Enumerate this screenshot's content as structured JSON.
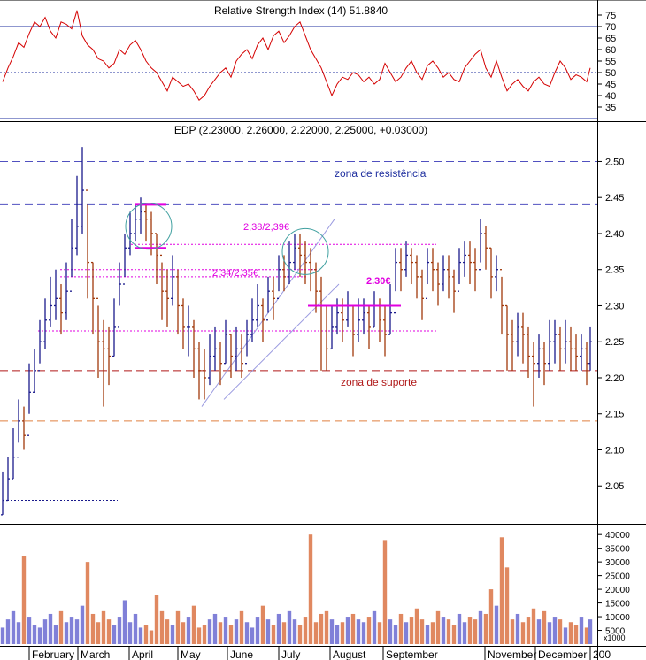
{
  "colors": {
    "up": "#1a1a8c",
    "down": "#a0380a",
    "rsi_line": "#d40000",
    "level_blue": "#1f2f9f",
    "resistance": "#5050c0",
    "support_red": "#b01818",
    "support_orange": "#e08040",
    "annotation": "#e000e0",
    "circle": "#40a0a0",
    "vol_up": "#8080d8",
    "vol_down": "#e08860",
    "channel": "#9a9ae0"
  },
  "chart_data": [
    {
      "type": "line",
      "title": "Relative Strength Index (14) 51.8840",
      "yticks": [
        35,
        40,
        45,
        50,
        55,
        60,
        65,
        70,
        75
      ],
      "ylim": [
        30,
        80
      ],
      "reference_levels": [
        30,
        50,
        70
      ],
      "x_range": [
        0,
        664
      ],
      "series": [
        {
          "x": [
            0,
            6,
            12,
            18,
            24,
            30,
            36,
            42,
            48,
            54,
            60,
            66,
            72,
            78,
            84,
            90,
            96,
            102,
            108,
            114,
            120,
            126,
            132,
            138,
            144,
            150,
            156,
            162,
            168,
            174,
            180,
            186,
            192,
            198,
            204,
            210,
            216,
            222,
            228,
            234,
            240,
            246,
            252,
            258,
            264,
            270,
            276,
            282,
            288,
            294,
            300,
            306,
            312,
            318,
            324,
            330,
            336,
            342,
            348,
            354,
            360,
            366,
            372,
            378,
            384,
            390,
            396,
            402,
            408,
            414,
            420,
            426,
            432,
            438,
            444,
            450,
            456,
            462,
            468,
            474,
            480,
            486,
            492,
            498,
            504,
            510,
            516,
            522,
            528,
            534,
            540,
            546,
            552,
            558,
            564,
            570,
            576,
            582,
            588,
            594,
            600,
            606,
            612,
            618,
            624,
            630,
            636,
            642,
            648,
            654,
            660,
            664
          ],
          "values": [
            46,
            52,
            57,
            63,
            61,
            67,
            72,
            70,
            74,
            68,
            65,
            72,
            71,
            69,
            77,
            66,
            62,
            60,
            56,
            55,
            52,
            54,
            60,
            58,
            62,
            64,
            60,
            55,
            52,
            50,
            46,
            42,
            48,
            46,
            44,
            45,
            42,
            38,
            40,
            44,
            47,
            50,
            52,
            48,
            55,
            58,
            60,
            56,
            62,
            65,
            60,
            66,
            68,
            63,
            66,
            70,
            72,
            66,
            60,
            56,
            52,
            46,
            40,
            45,
            48,
            47,
            50,
            49,
            46,
            48,
            45,
            47,
            54,
            50,
            46,
            48,
            52,
            55,
            50,
            47,
            53,
            55,
            52,
            48,
            50,
            47,
            46,
            52,
            55,
            58,
            60,
            52,
            48,
            55,
            48,
            42,
            45,
            47,
            44,
            42,
            46,
            48,
            45,
            44,
            50,
            55,
            52,
            47,
            49,
            48,
            46,
            52
          ]
        }
      ]
    },
    {
      "type": "candlestick",
      "title": "EDP (2.23000, 2.26000, 2.22000, 2.25000, +0.03000)",
      "yticks": [
        2.05,
        2.1,
        2.15,
        2.2,
        2.25,
        2.3,
        2.35,
        2.4,
        2.45,
        2.5
      ],
      "ylim": [
        2.0,
        2.53
      ],
      "x_range": [
        0,
        664
      ],
      "xticks": [
        "February",
        "March",
        "April",
        "May",
        "June",
        "July",
        "August",
        "September",
        "November",
        "December",
        "200"
      ],
      "xtick_pos": [
        30,
        85,
        143,
        198,
        254,
        312,
        370,
        430,
        545,
        602,
        664
      ],
      "annotations": {
        "resistance_label": "zona de resistência",
        "support_label": "zona de suporte",
        "label_238": "2,38/2,39€",
        "label_234": "2,34/2,35€",
        "label_230": "2.30€"
      },
      "levels": [
        {
          "y": 2.5,
          "style": "resistance"
        },
        {
          "y": 2.44,
          "style": "resistance"
        },
        {
          "y": 2.21,
          "style": "support_red"
        },
        {
          "y": 2.14,
          "style": "support_orange"
        }
      ],
      "dotted_levels": [
        {
          "y": 2.385,
          "x0": 145,
          "x1": 490
        },
        {
          "y": 2.35,
          "x0": 65,
          "x1": 360
        },
        {
          "y": 2.34,
          "x0": 65,
          "x1": 345
        },
        {
          "y": 2.265,
          "x0": 40,
          "x1": 490
        },
        {
          "y": 2.03,
          "x0": 5,
          "x1": 130
        }
      ],
      "trend_channel": [
        {
          "x0": 225,
          "y0": 2.16,
          "x1": 375,
          "y1": 2.42
        },
        {
          "x0": 250,
          "y0": 2.17,
          "x1": 380,
          "y1": 2.33
        }
      ],
      "highlight_segments": [
        {
          "y": 2.44,
          "x0": 150,
          "x1": 185
        },
        {
          "y": 2.38,
          "x0": 150,
          "x1": 185
        },
        {
          "y": 2.3,
          "x0": 345,
          "x1": 450
        }
      ],
      "circles": [
        {
          "x": 165,
          "y": 2.41,
          "r": 26
        },
        {
          "x": 342,
          "y": 2.375,
          "r": 26
        }
      ],
      "series": [
        {
          "x": [
            0,
            6,
            12,
            18,
            24,
            30,
            36,
            42,
            48,
            54,
            60,
            66,
            72,
            78,
            84,
            90,
            96,
            102,
            108,
            114,
            120,
            126,
            132,
            138,
            144,
            150,
            156,
            162,
            168,
            174,
            180,
            186,
            192,
            198,
            204,
            210,
            216,
            222,
            228,
            234,
            240,
            246,
            252,
            258,
            264,
            270,
            276,
            282,
            288,
            294,
            300,
            306,
            312,
            318,
            324,
            330,
            336,
            342,
            348,
            354,
            360,
            366,
            372,
            378,
            384,
            390,
            396,
            402,
            408,
            414,
            420,
            426,
            432,
            438,
            444,
            450,
            456,
            462,
            468,
            474,
            480,
            486,
            492,
            498,
            504,
            510,
            516,
            522,
            528,
            534,
            540,
            546,
            552,
            558,
            564,
            570,
            576,
            582,
            588,
            594,
            600,
            606,
            612,
            618,
            624,
            630,
            636,
            642,
            648,
            654,
            660,
            664
          ],
          "close": [
            2.03,
            2.06,
            2.09,
            2.14,
            2.12,
            2.18,
            2.21,
            2.25,
            2.28,
            2.3,
            2.31,
            2.29,
            2.32,
            2.38,
            2.41,
            2.46,
            2.36,
            2.31,
            2.25,
            2.24,
            2.23,
            2.27,
            2.33,
            2.38,
            2.4,
            2.42,
            2.43,
            2.42,
            2.4,
            2.37,
            2.32,
            2.31,
            2.34,
            2.3,
            2.27,
            2.27,
            2.24,
            2.21,
            2.2,
            2.23,
            2.24,
            2.22,
            2.26,
            2.23,
            2.24,
            2.22,
            2.26,
            2.28,
            2.3,
            2.28,
            2.32,
            2.31,
            2.35,
            2.34,
            2.36,
            2.38,
            2.37,
            2.36,
            2.35,
            2.32,
            2.3,
            2.24,
            2.27,
            2.29,
            2.28,
            2.3,
            2.26,
            2.28,
            2.29,
            2.27,
            2.3,
            2.28,
            2.26,
            2.29,
            2.36,
            2.35,
            2.37,
            2.36,
            2.34,
            2.31,
            2.36,
            2.35,
            2.33,
            2.35,
            2.34,
            2.32,
            2.36,
            2.37,
            2.36,
            2.35,
            2.4,
            2.38,
            2.34,
            2.35,
            2.3,
            2.26,
            2.25,
            2.27,
            2.26,
            2.23,
            2.22,
            2.24,
            2.22,
            2.25,
            2.26,
            2.24,
            2.25,
            2.24,
            2.23,
            2.24,
            2.22,
            2.25
          ],
          "high": [
            2.07,
            2.09,
            2.13,
            2.17,
            2.16,
            2.22,
            2.24,
            2.28,
            2.31,
            2.34,
            2.35,
            2.33,
            2.36,
            2.42,
            2.48,
            2.52,
            2.44,
            2.36,
            2.3,
            2.28,
            2.27,
            2.31,
            2.36,
            2.4,
            2.43,
            2.44,
            2.45,
            2.44,
            2.43,
            2.4,
            2.36,
            2.35,
            2.37,
            2.35,
            2.31,
            2.3,
            2.28,
            2.25,
            2.24,
            2.26,
            2.27,
            2.25,
            2.28,
            2.26,
            2.27,
            2.26,
            2.28,
            2.31,
            2.33,
            2.31,
            2.34,
            2.34,
            2.37,
            2.37,
            2.39,
            2.4,
            2.4,
            2.39,
            2.38,
            2.36,
            2.34,
            2.3,
            2.3,
            2.31,
            2.31,
            2.32,
            2.3,
            2.31,
            2.31,
            2.3,
            2.32,
            2.31,
            2.3,
            2.33,
            2.38,
            2.38,
            2.39,
            2.38,
            2.37,
            2.35,
            2.38,
            2.38,
            2.36,
            2.37,
            2.37,
            2.35,
            2.38,
            2.39,
            2.39,
            2.38,
            2.42,
            2.41,
            2.38,
            2.37,
            2.34,
            2.3,
            2.28,
            2.29,
            2.29,
            2.27,
            2.25,
            2.26,
            2.25,
            2.28,
            2.28,
            2.27,
            2.28,
            2.27,
            2.26,
            2.26,
            2.25,
            2.27
          ],
          "low": [
            2.01,
            2.03,
            2.06,
            2.11,
            2.1,
            2.15,
            2.18,
            2.22,
            2.24,
            2.27,
            2.28,
            2.26,
            2.28,
            2.34,
            2.37,
            2.4,
            2.31,
            2.26,
            2.2,
            2.16,
            2.19,
            2.23,
            2.3,
            2.34,
            2.37,
            2.39,
            2.4,
            2.39,
            2.37,
            2.33,
            2.28,
            2.27,
            2.3,
            2.26,
            2.24,
            2.23,
            2.2,
            2.17,
            2.17,
            2.19,
            2.21,
            2.19,
            2.22,
            2.2,
            2.21,
            2.2,
            2.23,
            2.25,
            2.27,
            2.25,
            2.29,
            2.28,
            2.32,
            2.32,
            2.33,
            2.35,
            2.34,
            2.33,
            2.32,
            2.29,
            2.21,
            2.21,
            2.24,
            2.26,
            2.25,
            2.27,
            2.23,
            2.25,
            2.26,
            2.24,
            2.27,
            2.25,
            2.23,
            2.26,
            2.32,
            2.32,
            2.34,
            2.33,
            2.31,
            2.28,
            2.33,
            2.32,
            2.3,
            2.32,
            2.31,
            2.29,
            2.33,
            2.34,
            2.33,
            2.32,
            2.36,
            2.35,
            2.31,
            2.32,
            2.26,
            2.21,
            2.21,
            2.23,
            2.22,
            2.2,
            2.16,
            2.2,
            2.19,
            2.21,
            2.22,
            2.21,
            2.22,
            2.21,
            2.21,
            2.21,
            2.19,
            2.21
          ]
        }
      ]
    },
    {
      "type": "bar",
      "title": "",
      "unit_label": "x1000",
      "yticks": [
        5000,
        10000,
        15000,
        20000,
        25000,
        30000,
        35000,
        40000
      ],
      "ylim": [
        0,
        42000
      ],
      "x_range": [
        0,
        664
      ],
      "series": [
        {
          "x": [
            0,
            6,
            12,
            18,
            24,
            30,
            36,
            42,
            48,
            54,
            60,
            66,
            72,
            78,
            84,
            90,
            96,
            102,
            108,
            114,
            120,
            126,
            132,
            138,
            144,
            150,
            156,
            162,
            168,
            174,
            180,
            186,
            192,
            198,
            204,
            210,
            216,
            222,
            228,
            234,
            240,
            246,
            252,
            258,
            264,
            270,
            276,
            282,
            288,
            294,
            300,
            306,
            312,
            318,
            324,
            330,
            336,
            342,
            348,
            354,
            360,
            366,
            372,
            378,
            384,
            390,
            396,
            402,
            408,
            414,
            420,
            426,
            432,
            438,
            444,
            450,
            456,
            462,
            468,
            474,
            480,
            486,
            492,
            498,
            504,
            510,
            516,
            522,
            528,
            534,
            540,
            546,
            552,
            558,
            564,
            570,
            576,
            582,
            588,
            594,
            600,
            606,
            612,
            618,
            624,
            630,
            636,
            642,
            648,
            654,
            660,
            664
          ],
          "values": [
            6000,
            9000,
            12000,
            8000,
            32000,
            10000,
            7000,
            6000,
            9000,
            11000,
            7000,
            12000,
            8000,
            10000,
            9000,
            14000,
            30000,
            11000,
            8000,
            12000,
            9000,
            7000,
            10000,
            16000,
            8000,
            11000,
            6000,
            7000,
            5000,
            18000,
            12000,
            9000,
            7000,
            12000,
            8000,
            10000,
            14000,
            6000,
            7000,
            9000,
            11000,
            8000,
            10000,
            7000,
            9000,
            12000,
            8000,
            6000,
            10000,
            14000,
            9000,
            7000,
            11000,
            8000,
            12000,
            9000,
            7000,
            10000,
            40000,
            8000,
            11000,
            12000,
            9000,
            7000,
            8000,
            10000,
            11000,
            9000,
            8000,
            10000,
            12000,
            8000,
            38000,
            9000,
            7000,
            11000,
            8000,
            10000,
            13000,
            9000,
            7000,
            8000,
            12000,
            10000,
            9000,
            7000,
            11000,
            8000,
            10000,
            9000,
            12000,
            11000,
            20000,
            14000,
            39000,
            28000,
            9000,
            11000,
            8000,
            10000,
            13000,
            9000,
            12000,
            8000,
            10000,
            9000,
            6000,
            8000,
            7000,
            10000,
            6000,
            9000
          ]
        }
      ]
    }
  ]
}
